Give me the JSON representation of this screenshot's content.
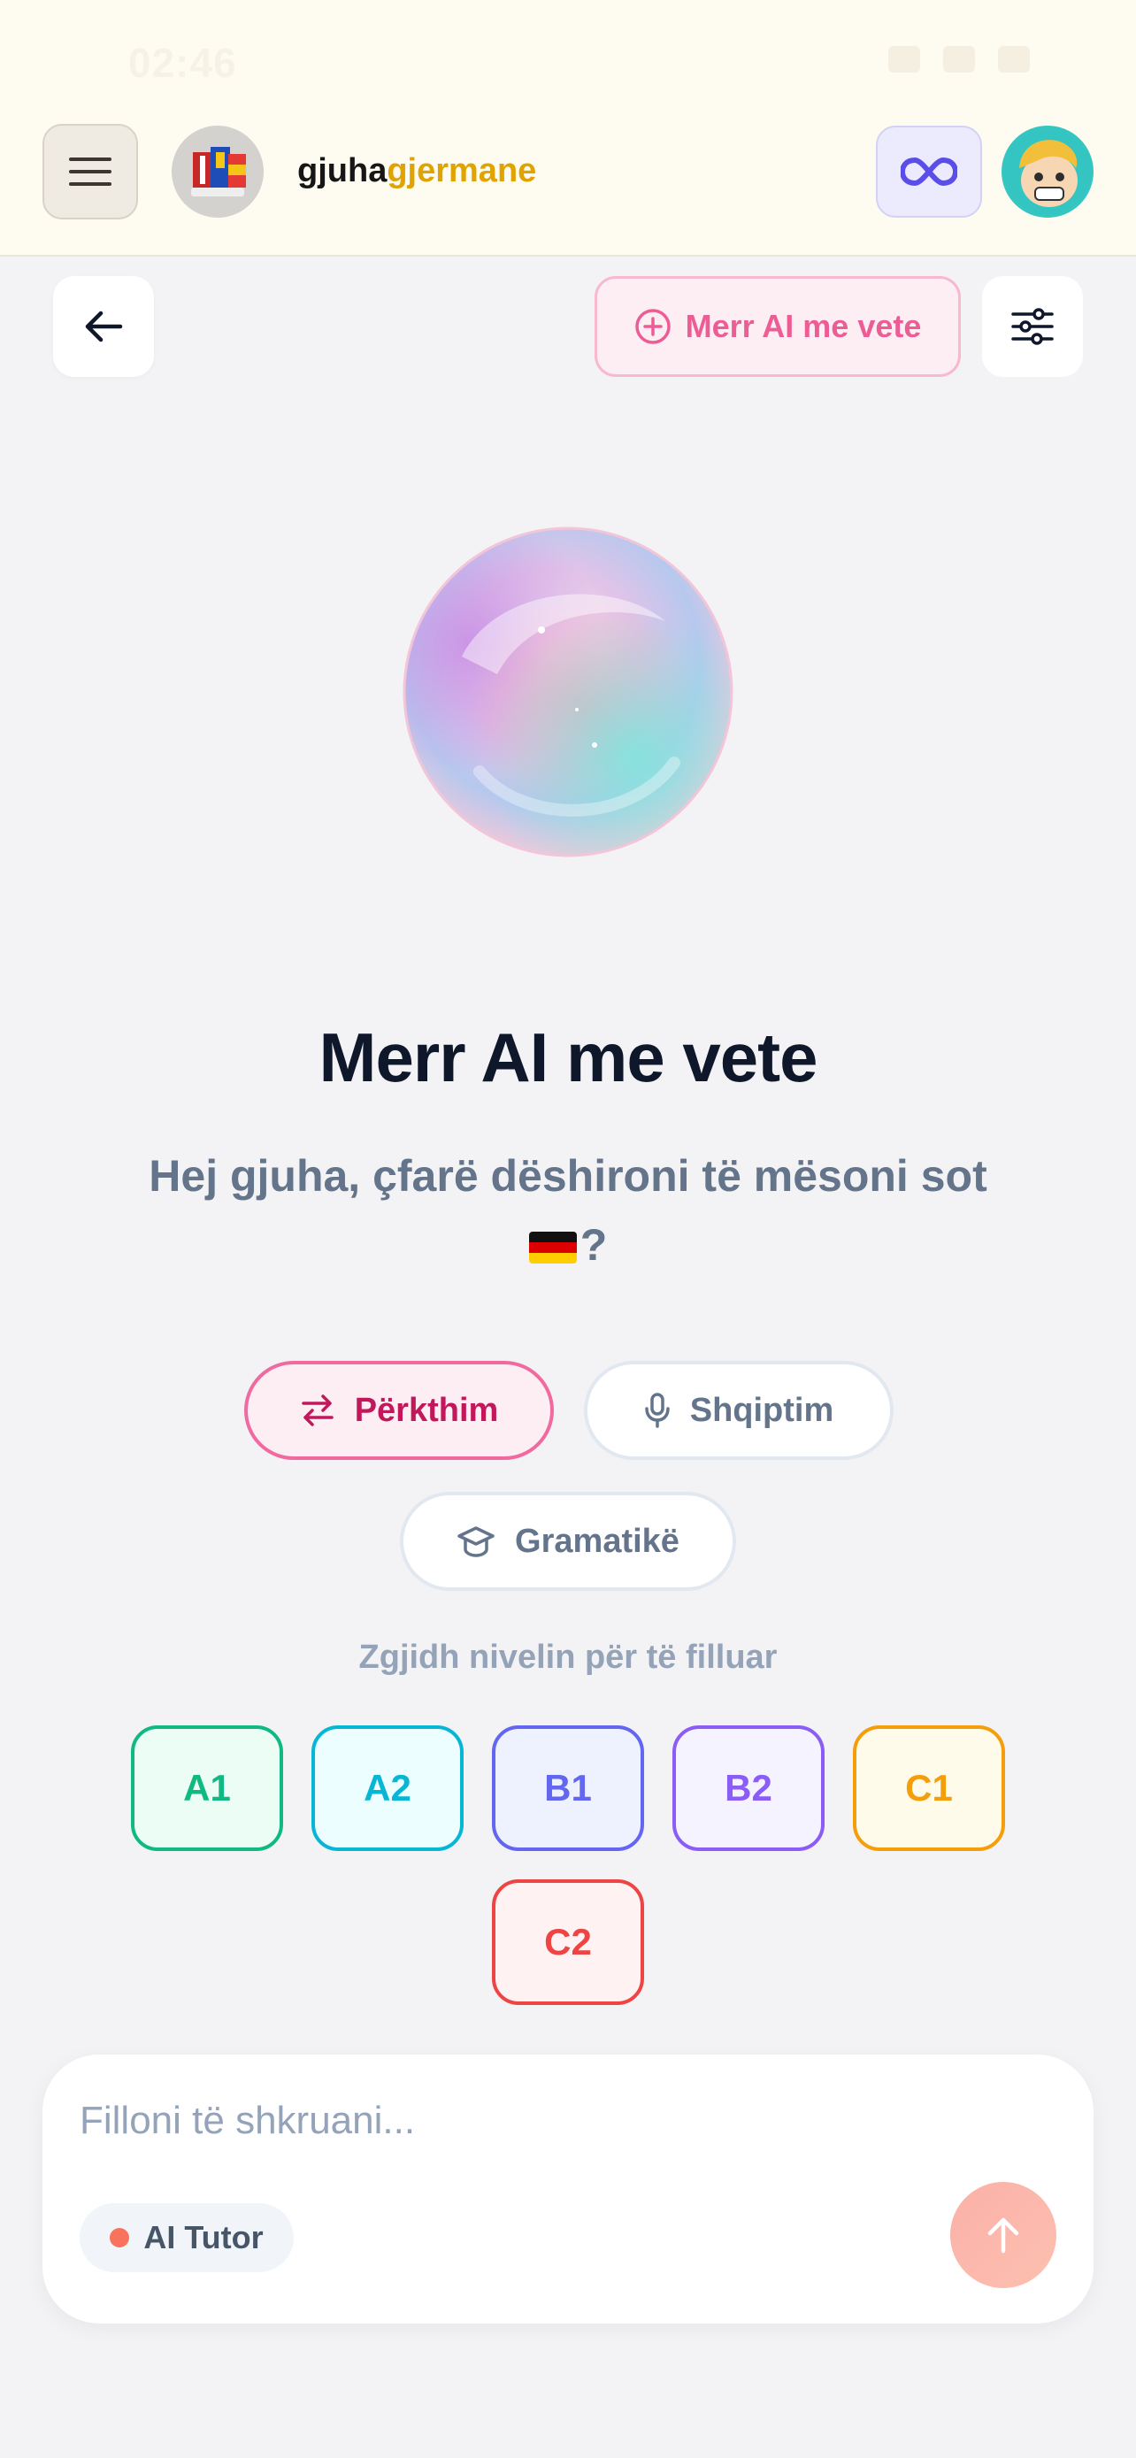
{
  "status_bar": {
    "time": "02:46"
  },
  "header": {
    "brand_part1": "gjuha",
    "brand_part2": "gjermane",
    "colors": {
      "brand_dark": "#161616",
      "brand_accent": "#e0a300"
    }
  },
  "actions": {
    "get_ai_label": "Merr AI me vete"
  },
  "hero": {
    "title": "Merr AI me vete",
    "subtitle_line1": "Hej gjuha, çfarë dëshironi të mësoni sot",
    "subtitle_end": "?"
  },
  "modes": [
    {
      "label": "Përkthim",
      "icon": "swap-arrows-icon",
      "active": true
    },
    {
      "label": "Shqiptim",
      "icon": "microphone-icon",
      "active": false
    },
    {
      "label": "Gramatikë",
      "icon": "graduation-cap-icon",
      "active": false
    }
  ],
  "levels": {
    "hint": "Zgjidh nivelin për të filluar",
    "items": [
      {
        "label": "A1",
        "color": "#10b981",
        "bg": "#ecfdf5"
      },
      {
        "label": "A2",
        "color": "#06b6d4",
        "bg": "#ecfeff"
      },
      {
        "label": "B1",
        "color": "#6366f1",
        "bg": "#eef2ff"
      },
      {
        "label": "B2",
        "color": "#8b5cf6",
        "bg": "#f5f3ff"
      },
      {
        "label": "C1",
        "color": "#f59e0b",
        "bg": "#fffbeb"
      },
      {
        "label": "C2",
        "color": "#ef4444",
        "bg": "#fef2f2"
      }
    ]
  },
  "composer": {
    "placeholder": "Filloni të shkruani...",
    "value": "",
    "tutor_label": "AI Tutor"
  }
}
